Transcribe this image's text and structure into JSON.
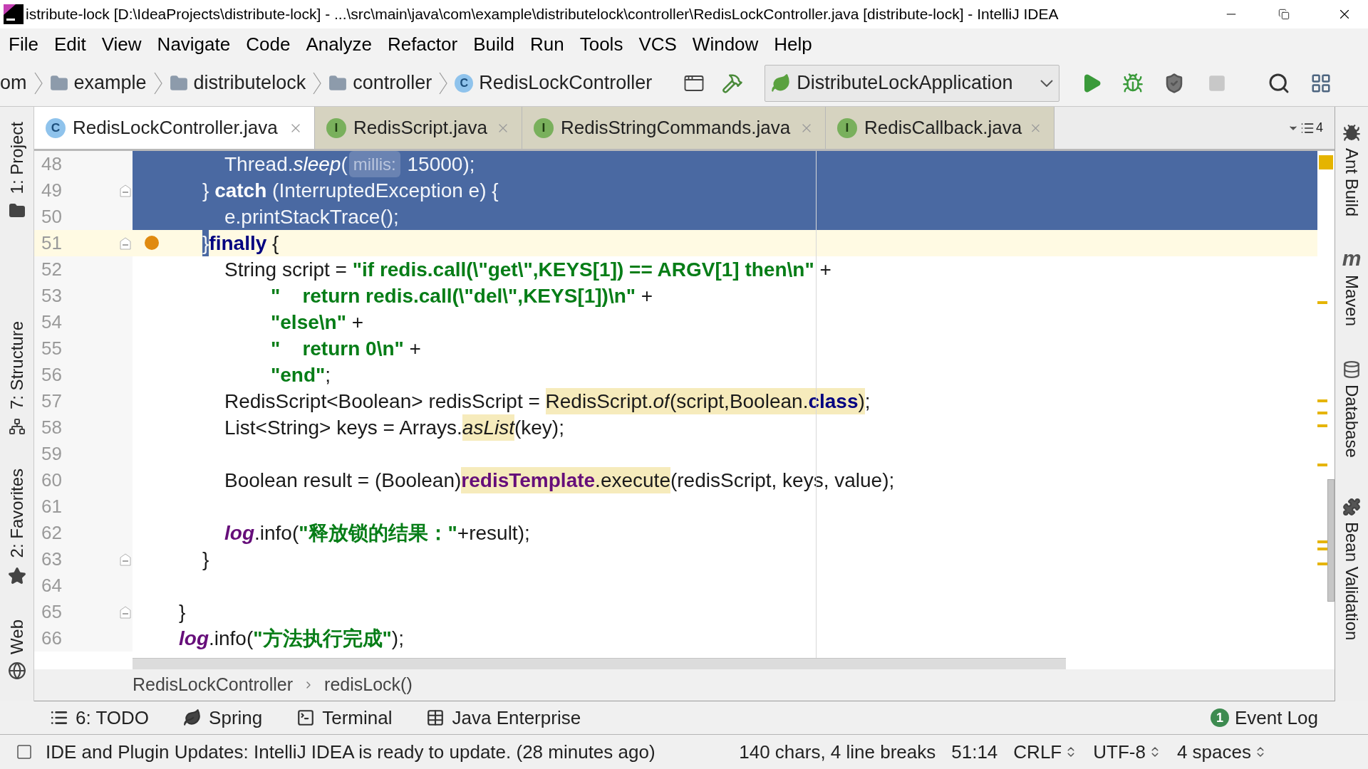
{
  "window": {
    "title": "istribute-lock [D:\\IdeaProjects\\distribute-lock] - ...\\src\\main\\java\\com\\example\\distributelock\\controller\\RedisLockController.java [distribute-lock] - IntelliJ IDEA"
  },
  "menu": [
    "File",
    "Edit",
    "View",
    "Navigate",
    "Code",
    "Analyze",
    "Refactor",
    "Build",
    "Run",
    "Tools",
    "VCS",
    "Window",
    "Help"
  ],
  "navigation": {
    "breadcrumbs": [
      {
        "label": "om",
        "kind": "text"
      },
      {
        "label": "example",
        "kind": "folder"
      },
      {
        "label": "distributelock",
        "kind": "folder"
      },
      {
        "label": "controller",
        "kind": "folder"
      },
      {
        "label": "RedisLockController",
        "kind": "class",
        "icon_letter": "C"
      }
    ],
    "run_config": "DistributeLockApplication"
  },
  "tabs": [
    {
      "label": "RedisLockController.java",
      "kind": "class",
      "icon_letter": "C",
      "selected": true
    },
    {
      "label": "RedisScript.java",
      "kind": "interface",
      "icon_letter": "I",
      "selected": false
    },
    {
      "label": "RedisStringCommands.java",
      "kind": "interface",
      "icon_letter": "I",
      "selected": false
    },
    {
      "label": "RedisCallback.java",
      "kind": "interface",
      "icon_letter": "I",
      "selected": false
    }
  ],
  "tabs_overflow": "4",
  "left_tools": [
    {
      "label": "1: Project",
      "kind": "folder"
    },
    {
      "label": "7: Structure",
      "kind": "structure"
    },
    {
      "label": "2: Favorites",
      "kind": "star"
    },
    {
      "label": "Web",
      "kind": "globe"
    }
  ],
  "right_tools": [
    {
      "label": "Ant Build",
      "kind": "ant"
    },
    {
      "label": "Maven",
      "kind": "maven",
      "glyph": "m"
    },
    {
      "label": "Database",
      "kind": "database"
    },
    {
      "label": "Bean Validation",
      "kind": "bean"
    }
  ],
  "editor": {
    "lines": [
      {
        "number": "48",
        "kind": "body",
        "selected": true,
        "current": false,
        "breakpoint": false,
        "fold": false,
        "segments": [
          {
            "text": "Thread.",
            "kind": "plain",
            "marked": false,
            "selected": true
          },
          {
            "text": "sleep",
            "kind": "static",
            "marked": false,
            "selected": true
          },
          {
            "text": "(",
            "kind": "plain",
            "marked": false,
            "selected": true
          },
          {
            "text": "millis:",
            "kind": "hint",
            "marked": false,
            "selected": true
          },
          {
            "text": " 15000);",
            "kind": "plain",
            "marked": false,
            "selected": true
          }
        ]
      },
      {
        "number": "49",
        "kind": "inner",
        "selected": true,
        "current": false,
        "breakpoint": false,
        "fold": true,
        "segments": [
          {
            "text": "} ",
            "kind": "plain",
            "marked": false,
            "selected": true
          },
          {
            "text": "catch",
            "kind": "keyword",
            "marked": false,
            "selected": true
          },
          {
            "text": " (InterruptedException e) {",
            "kind": "plain",
            "marked": false,
            "selected": true
          }
        ]
      },
      {
        "number": "50",
        "kind": "body",
        "selected": true,
        "current": false,
        "breakpoint": false,
        "fold": false,
        "segments": [
          {
            "text": "e.printStackTrace();",
            "kind": "plain",
            "marked": false,
            "selected": true
          }
        ]
      },
      {
        "number": "51",
        "kind": "inner",
        "selected": false,
        "current": true,
        "breakpoint": true,
        "fold": true,
        "segments": [
          {
            "text": "}",
            "kind": "plain",
            "marked": false,
            "selected": true
          },
          {
            "text": "finally",
            "kind": "keyword",
            "marked": false,
            "selected": false
          },
          {
            "text": " {",
            "kind": "plain",
            "marked": false,
            "selected": false
          }
        ]
      },
      {
        "number": "52",
        "kind": "body",
        "selected": false,
        "current": false,
        "breakpoint": false,
        "fold": false,
        "segments": [
          {
            "text": "String script = ",
            "kind": "plain",
            "marked": false,
            "selected": false
          },
          {
            "text": "\"if redis.call(\\\"get\\\",KEYS[1]) == ARGV[1] then\\n\"",
            "kind": "string",
            "marked": false,
            "selected": false
          },
          {
            "text": " +",
            "kind": "plain",
            "marked": false,
            "selected": false
          }
        ]
      },
      {
        "number": "53",
        "kind": "continuation",
        "selected": false,
        "current": false,
        "breakpoint": false,
        "fold": false,
        "segments": [
          {
            "text": "\"    return redis.call(\\\"del\\\",KEYS[1])\\n\"",
            "kind": "string",
            "marked": false,
            "selected": false
          },
          {
            "text": " +",
            "kind": "plain",
            "marked": false,
            "selected": false
          }
        ]
      },
      {
        "number": "54",
        "kind": "continuation",
        "selected": false,
        "current": false,
        "breakpoint": false,
        "fold": false,
        "segments": [
          {
            "text": "\"else\\n\"",
            "kind": "string",
            "marked": false,
            "selected": false
          },
          {
            "text": " +",
            "kind": "plain",
            "marked": false,
            "selected": false
          }
        ]
      },
      {
        "number": "55",
        "kind": "continuation",
        "selected": false,
        "current": false,
        "breakpoint": false,
        "fold": false,
        "segments": [
          {
            "text": "\"    return 0\\n\"",
            "kind": "string",
            "marked": false,
            "selected": false
          },
          {
            "text": " +",
            "kind": "plain",
            "marked": false,
            "selected": false
          }
        ]
      },
      {
        "number": "56",
        "kind": "continuation",
        "selected": false,
        "current": false,
        "breakpoint": false,
        "fold": false,
        "segments": [
          {
            "text": "\"end\"",
            "kind": "string",
            "marked": false,
            "selected": false
          },
          {
            "text": ";",
            "kind": "plain",
            "marked": false,
            "selected": false
          }
        ]
      },
      {
        "number": "57",
        "kind": "body",
        "selected": false,
        "current": false,
        "breakpoint": false,
        "fold": false,
        "segments": [
          {
            "text": "RedisScript<Boolean> redisScript = ",
            "kind": "plain",
            "marked": false,
            "selected": false
          },
          {
            "text": "RedisScript.",
            "kind": "plain",
            "marked": true,
            "selected": false
          },
          {
            "text": "of",
            "kind": "static",
            "marked": true,
            "selected": false
          },
          {
            "text": "(script,Boolean.",
            "kind": "plain",
            "marked": true,
            "selected": false
          },
          {
            "text": "class",
            "kind": "keyword",
            "marked": true,
            "selected": false
          },
          {
            "text": ")",
            "kind": "plain",
            "marked": true,
            "selected": false
          },
          {
            "text": ";",
            "kind": "plain",
            "marked": false,
            "selected": false
          }
        ]
      },
      {
        "number": "58",
        "kind": "body",
        "selected": false,
        "current": false,
        "breakpoint": false,
        "fold": false,
        "segments": [
          {
            "text": "List<String> keys = Arrays.",
            "kind": "plain",
            "marked": false,
            "selected": false
          },
          {
            "text": "asList",
            "kind": "static",
            "marked": true,
            "selected": false
          },
          {
            "text": "(key);",
            "kind": "plain",
            "marked": false,
            "selected": false
          }
        ]
      },
      {
        "number": "59",
        "selected": false,
        "current": false,
        "breakpoint": false,
        "fold": false
      },
      {
        "number": "60",
        "kind": "body",
        "selected": false,
        "current": false,
        "breakpoint": false,
        "fold": false,
        "segments": [
          {
            "text": "Boolean result = (Boolean)",
            "kind": "plain",
            "marked": false,
            "selected": false
          },
          {
            "text": "redisTemplate",
            "kind": "field",
            "marked": true,
            "selected": false
          },
          {
            "text": ".execute",
            "kind": "plain",
            "marked": true,
            "selected": false
          },
          {
            "text": "(redisScript, keys, value);",
            "kind": "plain",
            "marked": false,
            "selected": false
          }
        ]
      },
      {
        "number": "61",
        "selected": false,
        "current": false,
        "breakpoint": false,
        "fold": false
      },
      {
        "number": "62",
        "kind": "body",
        "selected": false,
        "current": false,
        "breakpoint": false,
        "fold": false,
        "segments": [
          {
            "text": "log",
            "kind": "static_field",
            "marked": false,
            "selected": false
          },
          {
            "text": ".info(",
            "kind": "plain",
            "marked": false,
            "selected": false
          },
          {
            "text": "\"释放锁的结果：\"",
            "kind": "string",
            "marked": false,
            "selected": false
          },
          {
            "text": "+result);",
            "kind": "plain",
            "marked": false,
            "selected": false
          }
        ]
      },
      {
        "number": "63",
        "kind": "inner",
        "selected": false,
        "current": false,
        "breakpoint": false,
        "fold": true,
        "segments": [
          {
            "text": "}",
            "kind": "plain",
            "marked": false,
            "selected": false
          }
        ]
      },
      {
        "number": "64",
        "selected": false,
        "current": false,
        "breakpoint": false,
        "fold": false
      },
      {
        "number": "65",
        "kind": "outer",
        "selected": false,
        "current": false,
        "breakpoint": false,
        "fold": true,
        "segments": [
          {
            "text": "}",
            "kind": "plain",
            "marked": false,
            "selected": false
          }
        ]
      },
      {
        "number": "66",
        "kind": "outer",
        "selected": false,
        "current": false,
        "breakpoint": false,
        "fold": false,
        "segments": [
          {
            "text": "log",
            "kind": "static_field",
            "marked": false,
            "selected": false
          },
          {
            "text": ".info(",
            "kind": "plain",
            "marked": false,
            "selected": false
          },
          {
            "text": "\"方法执行完成\"",
            "kind": "string",
            "marked": false,
            "selected": false
          },
          {
            "text": ");",
            "kind": "plain",
            "marked": false,
            "selected": false
          }
        ]
      }
    ]
  },
  "breadcrumb": [
    "RedisLockController",
    "redisLock()"
  ],
  "tool_windows": [
    {
      "label": "6: TODO",
      "kind": "todo"
    },
    {
      "label": "Spring",
      "kind": "spring"
    },
    {
      "label": "Terminal",
      "kind": "terminal"
    },
    {
      "label": "Java Enterprise",
      "kind": "enterprise"
    }
  ],
  "event_log": {
    "label": "Event Log",
    "count": "1"
  },
  "status_bar": {
    "message": "IDE and Plugin Updates: IntelliJ IDEA is ready to update. (28 minutes ago)",
    "items": [
      {
        "label": "140 chars, 4 line breaks",
        "dropdown": false
      },
      {
        "label": "51:14",
        "dropdown": false
      },
      {
        "label": "CRLF",
        "dropdown": true
      },
      {
        "label": "UTF-8",
        "dropdown": true
      },
      {
        "label": "4 spaces",
        "dropdown": true
      }
    ]
  }
}
